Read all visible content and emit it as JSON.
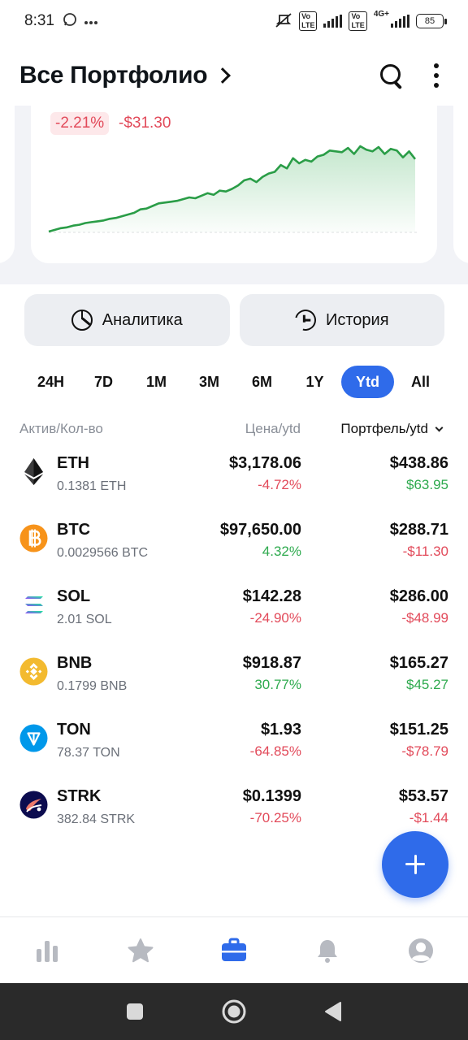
{
  "status_bar": {
    "time": "8:31",
    "battery": "85",
    "network": "4G+",
    "volte": "Vo LTE"
  },
  "header": {
    "title": "Все Портфолио"
  },
  "summary": {
    "change_percent": "-2.21%",
    "change_value": "-$31.30"
  },
  "chart_data": {
    "type": "area",
    "series": [
      {
        "values": [
          0.0,
          0.02,
          0.04,
          0.05,
          0.07,
          0.08,
          0.1,
          0.11,
          0.12,
          0.13,
          0.15,
          0.16,
          0.18,
          0.2,
          0.22,
          0.26,
          0.27,
          0.3,
          0.33,
          0.34,
          0.35,
          0.36,
          0.38,
          0.4,
          0.39,
          0.42,
          0.45,
          0.43,
          0.48,
          0.47,
          0.5,
          0.54,
          0.6,
          0.62,
          0.58,
          0.64,
          0.68,
          0.7,
          0.78,
          0.74,
          0.86,
          0.8,
          0.84,
          0.82,
          0.88,
          0.9,
          0.95,
          0.94,
          0.93,
          0.98,
          0.91,
          1.0,
          0.96,
          0.94,
          0.99,
          0.91,
          0.97,
          0.95,
          0.87,
          0.94,
          0.85
        ]
      }
    ],
    "line_color": "#2a9d47",
    "fill_color": "#2eaa4e"
  },
  "actions": {
    "analytics": "Аналитика",
    "history": "История"
  },
  "periods": [
    "24H",
    "7D",
    "1M",
    "3M",
    "6M",
    "1Y",
    "Ytd",
    "All"
  ],
  "active_period": "Ytd",
  "table": {
    "col_asset": "Актив/Кол-во",
    "col_price": "Цена/ytd",
    "col_portfolio": "Портфель/ytd"
  },
  "assets": [
    {
      "symbol": "ETH",
      "qty": "0.1381 ETH",
      "price": "$3,178.06",
      "price_change": "-4.72%",
      "price_dir": "neg",
      "value": "$438.86",
      "value_change": "$63.95",
      "value_dir": "pos",
      "icon": "eth-icon"
    },
    {
      "symbol": "BTC",
      "qty": "0.0029566 BTC",
      "price": "$97,650.00",
      "price_change": "4.32%",
      "price_dir": "pos",
      "value": "$288.71",
      "value_change": "-$11.30",
      "value_dir": "neg",
      "icon": "btc-icon"
    },
    {
      "symbol": "SOL",
      "qty": "2.01 SOL",
      "price": "$142.28",
      "price_change": "-24.90%",
      "price_dir": "neg",
      "value": "$286.00",
      "value_change": "-$48.99",
      "value_dir": "neg",
      "icon": "sol-icon"
    },
    {
      "symbol": "BNB",
      "qty": "0.1799 BNB",
      "price": "$918.87",
      "price_change": "30.77%",
      "price_dir": "pos",
      "value": "$165.27",
      "value_change": "$45.27",
      "value_dir": "pos",
      "icon": "bnb-icon"
    },
    {
      "symbol": "TON",
      "qty": "78.37 TON",
      "price": "$1.93",
      "price_change": "-64.85%",
      "price_dir": "neg",
      "value": "$151.25",
      "value_change": "-$78.79",
      "value_dir": "neg",
      "icon": "ton-icon"
    },
    {
      "symbol": "STRK",
      "qty": "382.84 STRK",
      "price": "$0.1399",
      "price_change": "-70.25%",
      "price_dir": "neg",
      "value": "$53.57",
      "value_change": "-$1.44",
      "value_dir": "neg",
      "icon": "strk-icon"
    }
  ],
  "nav": [
    "market-icon",
    "favorites-icon",
    "portfolio-icon",
    "alerts-icon",
    "profile-icon"
  ],
  "nav_active": "portfolio-icon",
  "colors": {
    "accent": "#2f6bea",
    "negative": "#e24a5a",
    "positive": "#2eaa4e",
    "inactive_nav": "#b7bac1"
  }
}
